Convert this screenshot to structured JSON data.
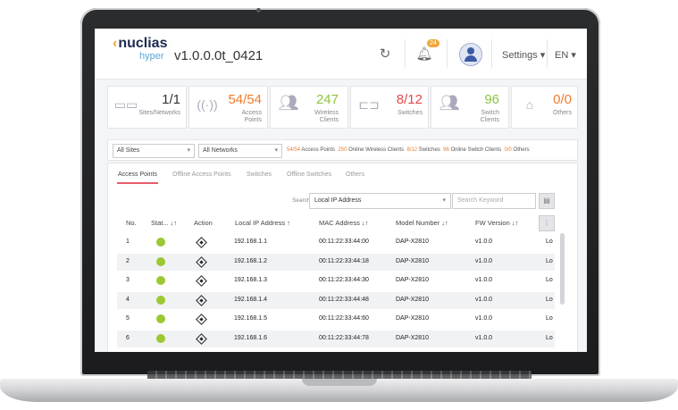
{
  "header": {
    "logo_chevron": "‹",
    "logo_text": "nuclias",
    "logo_sub": "hyper",
    "version": "v1.0.0.0t_0421",
    "refresh_icon": "refresh-icon",
    "notification_count": "24",
    "settings_label": "Settings ▾",
    "language_label": "EN ▾"
  },
  "stats": [
    {
      "name": "sites",
      "value": "1/1",
      "label": "Sites/Networks",
      "color": "#333333"
    },
    {
      "name": "access-points",
      "value": "54/54",
      "label": "Access Points",
      "color": "#f07c2a"
    },
    {
      "name": "wireless-clients",
      "value": "247",
      "label": "Wireless Clients",
      "color": "#8cc43e"
    },
    {
      "name": "switches",
      "value": "8/12",
      "label": "Switches",
      "color": "#e04a4a"
    },
    {
      "name": "switch-clients",
      "value": "96",
      "label": "Switch Clients",
      "color": "#8cc43e"
    },
    {
      "name": "others",
      "value": "0/0",
      "label": "Others",
      "color": "#f07c2a"
    }
  ],
  "filter": {
    "site_select": "All Sites",
    "network_select": "All Networks",
    "summary": [
      {
        "num": "54/54",
        "text": " Access Points"
      },
      {
        "num": "250",
        "text": " Online Wireless Clients"
      },
      {
        "num": "8/12",
        "text": " Switches"
      },
      {
        "num": "96",
        "text": " Online Switch Clients"
      },
      {
        "num": "0/0",
        "text": " Others"
      }
    ]
  },
  "tabs": [
    "Access Points",
    "Offline Access Points",
    "Switches",
    "Offline Switches",
    "Others"
  ],
  "search": {
    "label": "Search",
    "field_value": "Local IP Address",
    "keyword_placeholder": "Search Keyword"
  },
  "table": {
    "columns": [
      "No.",
      "Stat... ↓↑",
      "Action",
      "Local IP Address ↑",
      "MAC Address ↓↑",
      "Model Number ↓↑",
      "FW Version ↓↑",
      ""
    ],
    "rows": [
      {
        "no": "1",
        "ip": "192.168.1.1",
        "mac": "00:11:22:33:44:00",
        "model": "DAP-X2810",
        "fw": "v1.0.0",
        "extra": "Lo"
      },
      {
        "no": "2",
        "ip": "192.168.1.2",
        "mac": "00:11:22:33:44:18",
        "model": "DAP-X2810",
        "fw": "v1.0.0",
        "extra": "Lo"
      },
      {
        "no": "3",
        "ip": "192.168.1.3",
        "mac": "00:11:22:33:44:30",
        "model": "DAP-X2810",
        "fw": "v1.0.0",
        "extra": "Lo"
      },
      {
        "no": "4",
        "ip": "192.168.1.4",
        "mac": "00:11:22:33:44:48",
        "model": "DAP-X2810",
        "fw": "v1.0.0",
        "extra": "Lo"
      },
      {
        "no": "5",
        "ip": "192.168.1.5",
        "mac": "00:11:22:33:44:60",
        "model": "DAP-X2810",
        "fw": "v1.0.0",
        "extra": "Lo"
      },
      {
        "no": "6",
        "ip": "192.168.1.6",
        "mac": "00:11:22:33:44:78",
        "model": "DAP-X2810",
        "fw": "v1.0.0",
        "extra": "Lo"
      }
    ]
  },
  "colors": {
    "accent": "#e85c6a",
    "online": "#9cc833",
    "brand": "#1d2b52"
  }
}
